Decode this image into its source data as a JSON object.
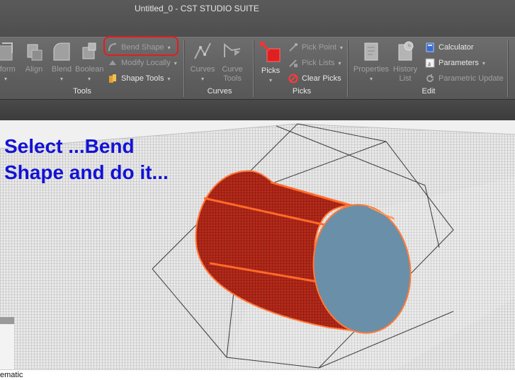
{
  "window": {
    "title": "Untitled_0 - CST STUDIO SUITE"
  },
  "ribbon": {
    "tools": {
      "label": "Tools",
      "transform": "sform",
      "align": "Align",
      "blend": "Blend",
      "boolean": "Boolean",
      "bend_shape": "Bend Shape",
      "modify_locally": "Modify Locally",
      "shape_tools": "Shape Tools"
    },
    "curves": {
      "label": "Curves",
      "curves": "Curves",
      "curve_tools_1": "Curve",
      "curve_tools_2": "Tools"
    },
    "picks": {
      "label": "Picks",
      "picks": "Picks",
      "pick_point": "Pick Point",
      "pick_lists": "Pick Lists",
      "clear_picks": "Clear Picks"
    },
    "edit": {
      "label": "Edit",
      "properties": "Properties",
      "history_1": "History",
      "history_2": "List",
      "calculator": "Calculator",
      "parameters": "Parameters",
      "parametric_update": "Parametric Update"
    }
  },
  "viewport": {
    "instruction_line1": "Select ...Bend",
    "instruction_line2": "Shape and do it...",
    "colors": {
      "cylinder_body": "#a8281a",
      "cylinder_face": "#6a8fa8",
      "outline": "#ff7a3a",
      "instruction": "#1212d6"
    }
  },
  "status": {
    "text": "ematic"
  }
}
